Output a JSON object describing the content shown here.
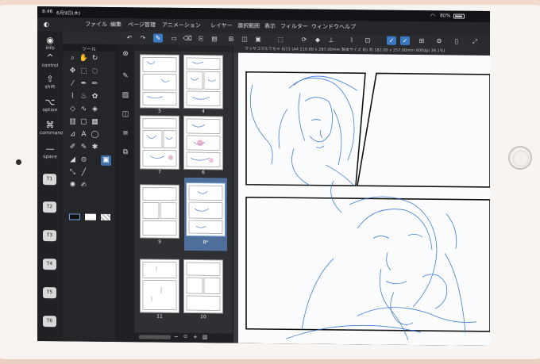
{
  "status": {
    "time": "8:46",
    "date": "6月9日(木)",
    "wifi": "wifi-icon",
    "battery": "80%"
  },
  "menu": [
    "ファイル",
    "編集",
    "ページ管理",
    "アニメーション",
    "レイヤー",
    "選択範囲",
    "表示",
    "フィルター",
    "ウィンドウ",
    "ヘルプ"
  ],
  "edgebar": {
    "info": "info",
    "keys": [
      {
        "glyph": "^",
        "label": "control"
      },
      {
        "glyph": "⇧",
        "label": "shift"
      },
      {
        "glyph": "⌥",
        "label": "option"
      },
      {
        "glyph": "⌘",
        "label": "command"
      },
      {
        "glyph": "—",
        "label": "space"
      }
    ],
    "t_keys": [
      "T1",
      "T2",
      "T3",
      "T4",
      "T5",
      "T6"
    ]
  },
  "toolpanel": {
    "title": "ツール"
  },
  "canvas": {
    "title": "マッサコマルでちゃ 6/11 (A4 210.00 x 297.00mm 製本サイズ B5 判 182.00 x 257.00mm 600dpi 39.1%)"
  },
  "pages": [
    {
      "label": "5"
    },
    {
      "label": "4"
    },
    {
      "label": "7"
    },
    {
      "label": "6"
    },
    {
      "label": "9"
    },
    {
      "label": "8*"
    },
    {
      "label": "11"
    },
    {
      "label": "10"
    }
  ],
  "pagefooter": {
    "minus": "−",
    "plus": "+"
  },
  "colors": {
    "accent": "#3a78c4",
    "sketch": "#2f6fd0"
  }
}
